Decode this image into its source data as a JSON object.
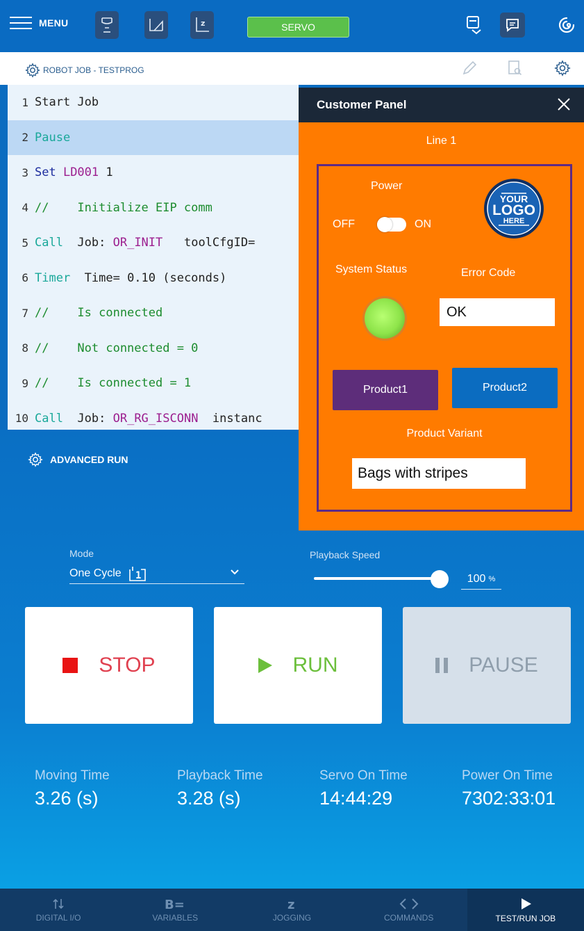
{
  "topbar": {
    "menu_label": "MENU",
    "servo_label": "SERVO",
    "servo_color": "#5bc04b"
  },
  "job": {
    "title": "ROBOT JOB - TESTPROG"
  },
  "code_lines": [
    {
      "n": "1",
      "parts": [
        {
          "t": "Start Job",
          "c": "dark"
        }
      ]
    },
    {
      "n": "2",
      "parts": [
        {
          "t": "Pause",
          "c": "teal"
        }
      ],
      "active": true
    },
    {
      "n": "3",
      "parts": [
        {
          "t": "Set ",
          "c": "blue"
        },
        {
          "t": "LD001",
          "c": "purple"
        },
        {
          "t": " 1",
          "c": "dark"
        }
      ]
    },
    {
      "n": "4",
      "parts": [
        {
          "t": "//    Initialize EIP comm",
          "c": "green"
        }
      ]
    },
    {
      "n": "5",
      "parts": [
        {
          "t": "Call",
          "c": "teal"
        },
        {
          "t": "  Job: ",
          "c": "dark"
        },
        {
          "t": "OR_INIT",
          "c": "purple"
        },
        {
          "t": "   toolCfgID=",
          "c": "dark"
        }
      ]
    },
    {
      "n": "6",
      "parts": [
        {
          "t": "Timer",
          "c": "teal"
        },
        {
          "t": "  Time= 0.10 (seconds)",
          "c": "dark"
        }
      ]
    },
    {
      "n": "7",
      "parts": [
        {
          "t": "//    Is connected",
          "c": "green"
        }
      ]
    },
    {
      "n": "8",
      "parts": [
        {
          "t": "//    Not connected = 0",
          "c": "green"
        }
      ]
    },
    {
      "n": "9",
      "parts": [
        {
          "t": "//    Is connected = 1",
          "c": "green"
        }
      ]
    },
    {
      "n": "10",
      "parts": [
        {
          "t": "Call",
          "c": "teal"
        },
        {
          "t": "  Job: ",
          "c": "dark"
        },
        {
          "t": "OR_RG_ISCONN",
          "c": "purple"
        },
        {
          "t": "  instanc",
          "c": "dark"
        }
      ]
    }
  ],
  "advanced": {
    "label": "ADVANCED RUN",
    "mode_caption": "Mode",
    "mode_value": "One Cycle",
    "speed_caption": "Playback Speed",
    "speed_value": "100",
    "speed_unit": "%",
    "speed_fraction": 1.0
  },
  "buttons": {
    "stop": "STOP",
    "run": "RUN",
    "pause": "PAUSE"
  },
  "stats": [
    {
      "caption": "Moving Time",
      "value": "3.26 (s)"
    },
    {
      "caption": "Playback Time",
      "value": "3.28 (s)"
    },
    {
      "caption": "Servo On Time",
      "value": "14:44:29"
    },
    {
      "caption": "Power On Time",
      "value": "7302:33:01"
    }
  ],
  "nav": [
    {
      "label": "DIGITAL I/O",
      "icon": "digital-io-icon"
    },
    {
      "label": "VARIABLES",
      "icon": "variables-icon"
    },
    {
      "label": "JOGGING",
      "icon": "jogging-icon"
    },
    {
      "label": "COMMANDS",
      "icon": "commands-icon"
    },
    {
      "label": "TEST/RUN JOB",
      "icon": "play-icon",
      "active": true
    }
  ],
  "panel": {
    "title": "Customer Panel",
    "line_title": "Line 1",
    "power_label": "Power",
    "off_label": "OFF",
    "on_label": "ON",
    "power_on": false,
    "logo_text": [
      "YOUR",
      "LOGO",
      "HERE"
    ],
    "system_status_label": "System Status",
    "error_code_label": "Error Code",
    "error_code_value": "OK",
    "product1": "Product1",
    "product2": "Product2",
    "variant_label": "Product Variant",
    "variant_value": "Bags with stripes",
    "bg_color": "#ff7b00",
    "border_color": "#5d2a86"
  }
}
